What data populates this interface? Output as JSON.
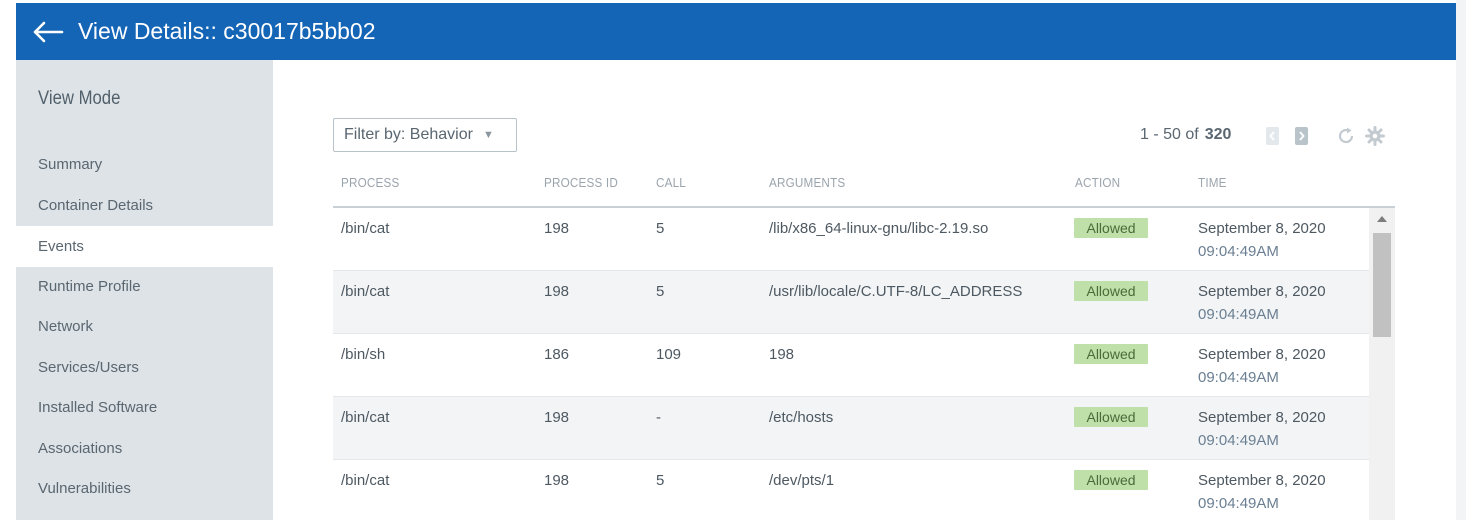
{
  "header": {
    "title": "View Details:: c30017b5bb02",
    "back_icon": "arrow-left-icon",
    "color": "#1565b6"
  },
  "sidebar": {
    "title": "View Mode",
    "items": [
      {
        "label": "Summary"
      },
      {
        "label": "Container Details"
      },
      {
        "label": "Events",
        "active": true
      },
      {
        "label": "Runtime Profile"
      },
      {
        "label": "Network"
      },
      {
        "label": "Services/Users"
      },
      {
        "label": "Installed Software"
      },
      {
        "label": "Associations"
      },
      {
        "label": "Vulnerabilities"
      }
    ]
  },
  "filter": {
    "label": "Filter by: Behavior",
    "caret_icon": "caret-down-icon"
  },
  "pagination": {
    "range": "1 - 50 of",
    "total": "320",
    "prev_icon": "chevron-left-icon",
    "next_icon": "chevron-right-icon"
  },
  "toolbar": {
    "refresh_icon": "refresh-icon",
    "settings_icon": "gear-icon"
  },
  "table": {
    "columns": [
      "PROCESS",
      "PROCESS ID",
      "CALL",
      "ARGUMENTS",
      "ACTION",
      "TIME"
    ],
    "rows": [
      {
        "process": "/bin/cat",
        "pid": "198",
        "call": "5",
        "arguments": "/lib/x86_64-linux-gnu/libc-2.19.so",
        "action": "Allowed",
        "date": "September 8, 2020",
        "time": "09:04:49AM"
      },
      {
        "process": "/bin/cat",
        "pid": "198",
        "call": "5",
        "arguments": "/usr/lib/locale/C.UTF-8/LC_ADDRESS",
        "action": "Allowed",
        "date": "September 8, 2020",
        "time": "09:04:49AM"
      },
      {
        "process": "/bin/sh",
        "pid": "186",
        "call": "109",
        "arguments": "198",
        "action": "Allowed",
        "date": "September 8, 2020",
        "time": "09:04:49AM"
      },
      {
        "process": "/bin/cat",
        "pid": "198",
        "call": "-",
        "arguments": "/etc/hosts",
        "action": "Allowed",
        "date": "September 8, 2020",
        "time": "09:04:49AM"
      },
      {
        "process": "/bin/cat",
        "pid": "198",
        "call": "5",
        "arguments": "/dev/pts/1",
        "action": "Allowed",
        "date": "September 8, 2020",
        "time": "09:04:49AM"
      }
    ]
  },
  "colors": {
    "allowed_badge": "#bfe0a8",
    "sidebar_bg": "#dde3e7"
  }
}
